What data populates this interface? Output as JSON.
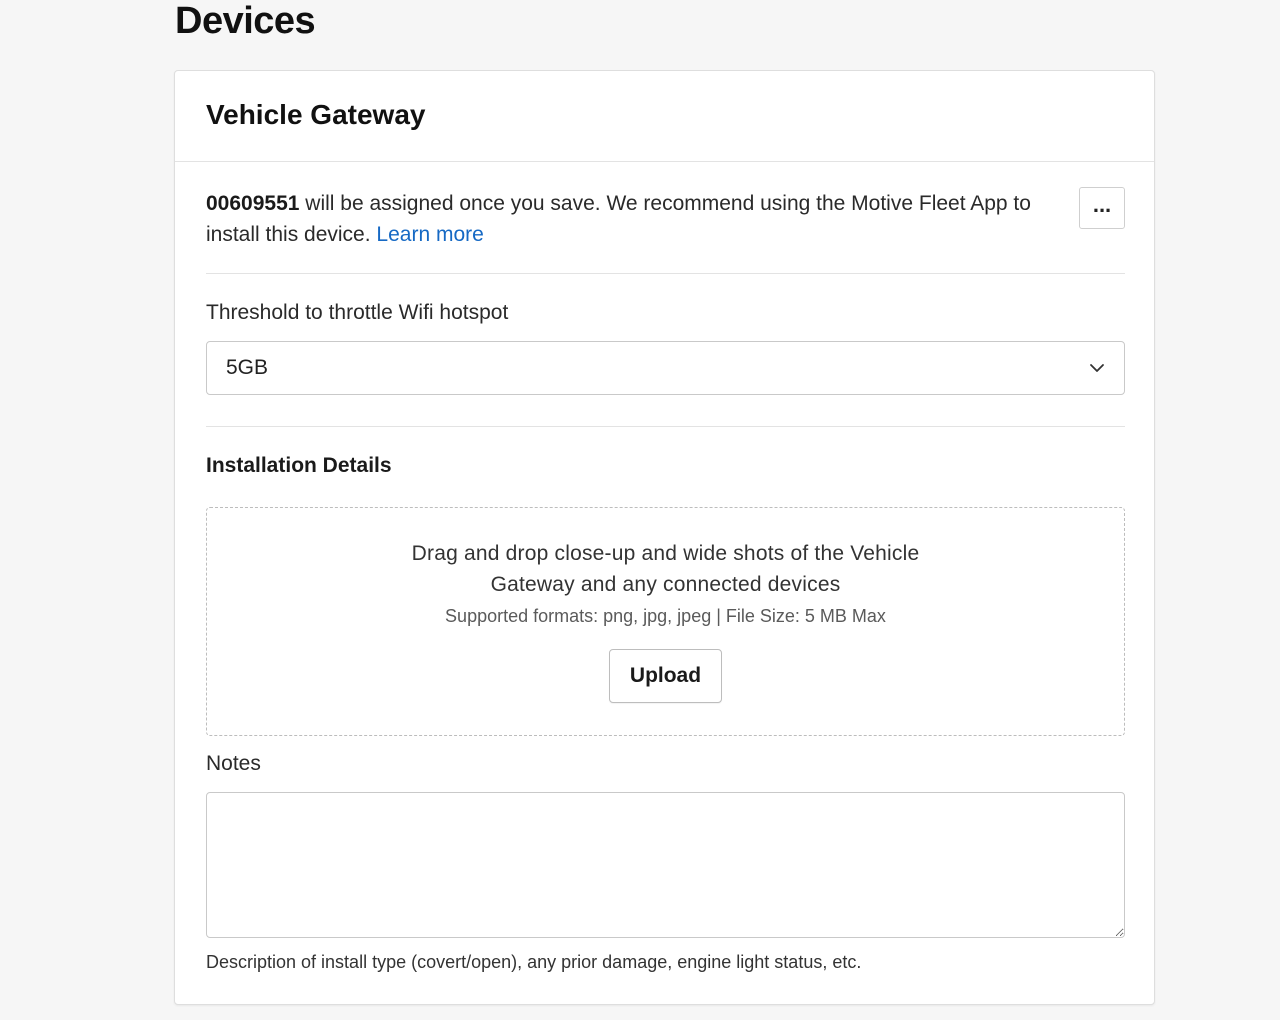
{
  "page": {
    "title": "Devices"
  },
  "card": {
    "title": "Vehicle Gateway",
    "notice": {
      "serial": "00609551",
      "text": " will be assigned once you save. We recommend using the Motive Fleet App to install this device. ",
      "link_label": "Learn more"
    },
    "more_button_label": "..."
  },
  "throttle": {
    "label": "Threshold to throttle Wifi hotspot",
    "selected_value": "5GB"
  },
  "installation": {
    "section_title": "Installation Details",
    "dropzone_text": "Drag and drop close-up and wide shots of the Vehicle Gateway and any connected devices",
    "supported_formats": "Supported formats: png, jpg, jpeg | File Size: 5 MB Max",
    "upload_label": "Upload"
  },
  "notes": {
    "label": "Notes",
    "value": "",
    "helper_text": "Description of install type (covert/open), any prior damage, engine light status, etc."
  },
  "colors": {
    "link": "#1669c4",
    "background": "#f6f6f6",
    "card": "#ffffff"
  },
  "icons": {
    "more": "ellipsis-icon",
    "select": "chevron-down-icon"
  }
}
